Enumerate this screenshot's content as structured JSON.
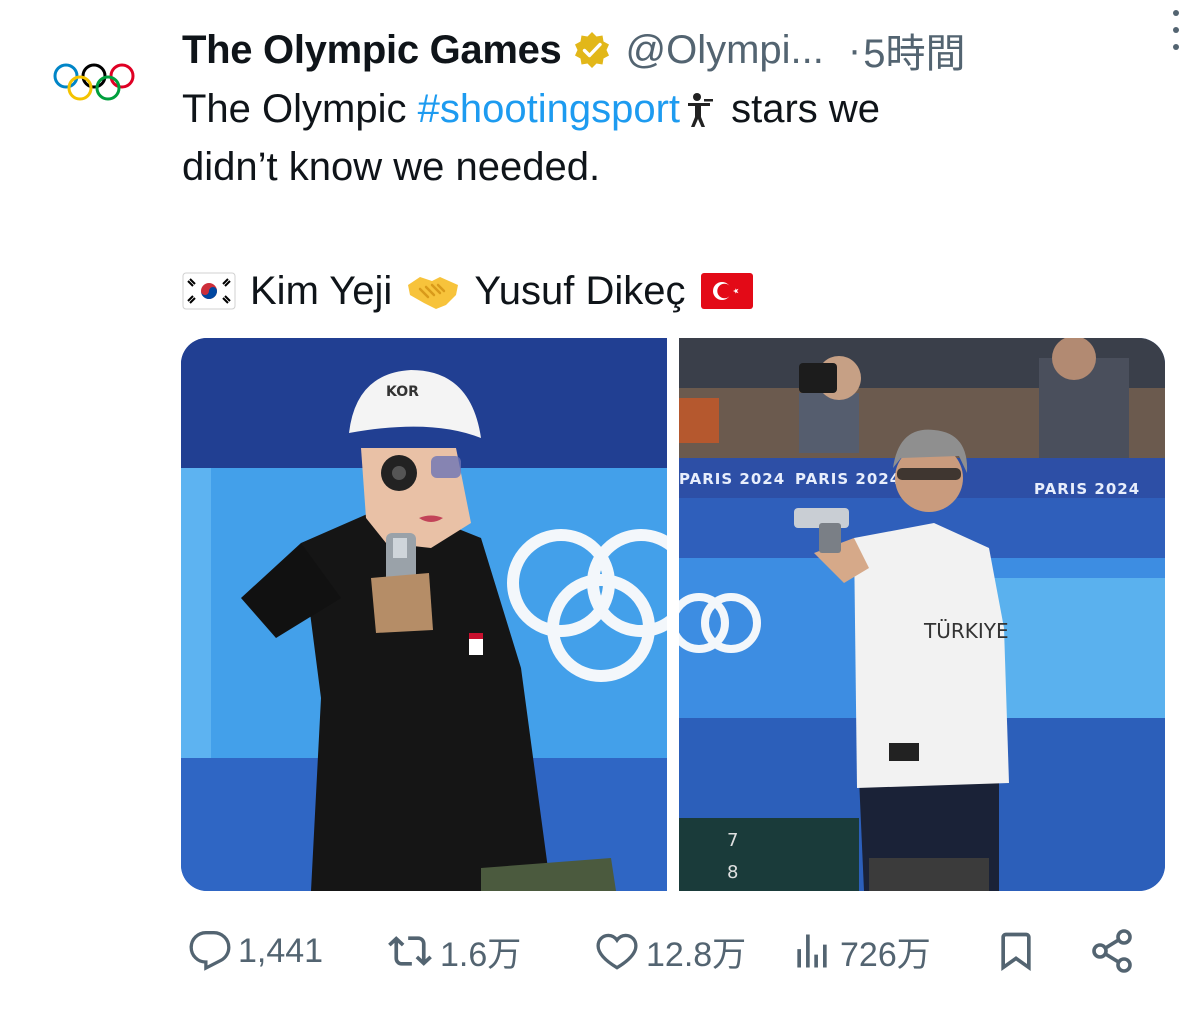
{
  "account": {
    "display_name": "The Olympic Games",
    "handle": "@Olympi...",
    "separator": "·",
    "time": "5時間",
    "avatar_icon": "olympic-rings-icon",
    "verified_icon": "gold-verified-badge-icon"
  },
  "tweet": {
    "line1_prefix": "The Olympic ",
    "hashtag": "#shootingsport",
    "line1_emoji": "shooter-emoji",
    "line1_suffix": " stars we",
    "line2": "didn’t know we needed.",
    "athlete_1": "Kim Yeji",
    "athlete_1_flag": "south-korea-flag",
    "connector_emoji": "handshake-emoji",
    "athlete_2": "Yusuf Dikeç",
    "athlete_2_flag": "turkey-flag"
  },
  "media": {
    "left": {
      "subject": "Kim Yeji aiming pistol",
      "cap_text": "KOR"
    },
    "right": {
      "subject": "Yusuf Dikeç aiming pistol",
      "banner_text": "PARIS 2024",
      "shirt_text": "TÜRKIYE",
      "target_numbers": [
        "7",
        "8"
      ]
    }
  },
  "actions": {
    "replies": "1,441",
    "reposts": "1.6万",
    "likes": "12.8万",
    "views": "726万",
    "reply_icon": "reply-icon",
    "repost_icon": "repost-icon",
    "like_icon": "heart-icon",
    "views_icon": "views-chart-icon",
    "bookmark_icon": "bookmark-icon",
    "share_icon": "share-icon"
  },
  "colors": {
    "text": "#0f1419",
    "secondary": "#536471",
    "link": "#1d9bf0",
    "verified_gold": "#e2b719"
  }
}
